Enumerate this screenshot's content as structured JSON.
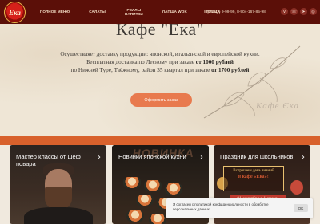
{
  "header": {
    "logo_text": "Ека",
    "nav": [
      {
        "label": "Полное меню"
      },
      {
        "label": "Салаты"
      },
      {
        "label": "Роллы\nНапитки"
      },
      {
        "label": "Лапша WOK"
      },
      {
        "label": "Пицца"
      }
    ],
    "phones": "8 (34542) 9-99-99, 8-904-167-85-98",
    "social": [
      {
        "icon": "vk-icon",
        "glyph": "v"
      },
      {
        "icon": "whatsapp-icon",
        "glyph": "☏"
      },
      {
        "icon": "telegram-icon",
        "glyph": "➤"
      },
      {
        "icon": "instagram-icon",
        "glyph": "◎"
      }
    ]
  },
  "hero": {
    "title": "Кафе \"Ека\"",
    "line1": "Осуществляет доставку продукции: японской, итальянской и европейской кухни.",
    "line2_pre": "Бесплатная доставка по Лесному при заказе ",
    "line2_bold": "от 1000 рублей",
    "line3_pre": "по Нижней Туре, Таёжному, район 35 квартал при заказе ",
    "line3_bold": "от 1700 рублей",
    "cta_label": "Оформить заказ",
    "signature": "Кафе Єка"
  },
  "cards": [
    {
      "title": "Мастер классы от шеф повара"
    },
    {
      "title": "Новинки японской кухни",
      "overlay": "НОВИНКА"
    },
    {
      "title": "Праздник для школьников",
      "sign_line1": "Встречаем день знаний",
      "sign_line2": "в кафе «Ека»!",
      "ribbon": "01 сентября в 1 смену"
    }
  ],
  "cookie": {
    "text": "Я согласен с политикой конфиденциальности в обработке персональных данных.",
    "ok_label": "OK"
  },
  "colors": {
    "topbar": "#5b0f08",
    "cta": "#e87a4e",
    "stripe": "#d8612c"
  }
}
